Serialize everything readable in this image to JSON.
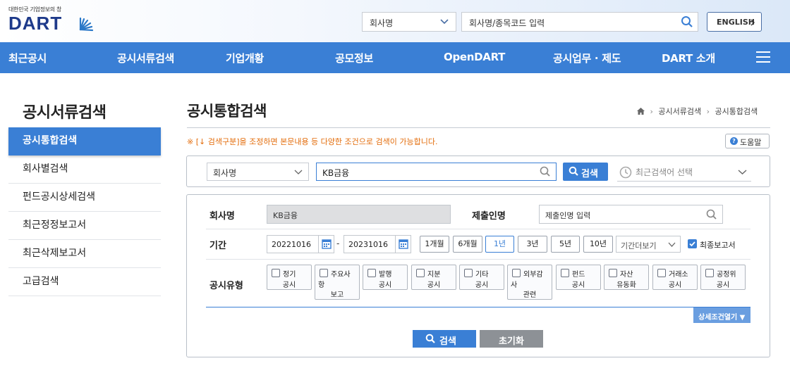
{
  "header": {
    "logo_tagline": "대한민국 기업정보의 창",
    "logo_word": "DART",
    "search_select": "회사명",
    "search_placeholder": "회사명/종목코드 입력",
    "english_label": "ENGLISH"
  },
  "nav": {
    "items": [
      "최근공시",
      "공시서류검색",
      "기업개황",
      "공모정보",
      "OpenDART",
      "공시업무 · 제도",
      "DART 소개"
    ]
  },
  "sidebar": {
    "title": "공시서류검색",
    "items": [
      "공시통합검색",
      "회사별검색",
      "펀드공시상세검색",
      "최근정정보고서",
      "최근삭제보고서",
      "고급검색"
    ]
  },
  "main": {
    "title": "공시통합검색",
    "breadcrumb": [
      "공시서류검색",
      "공시통합검색"
    ],
    "notice": "※ [↓ 검색구분]을 조정하면 본문내용 등 다양한 조건으로 검색이 가능합니다.",
    "help_label": "도움말"
  },
  "search_bar": {
    "select_value": "회사명",
    "input_value": "KB금융",
    "search_label": "검색",
    "recent_placeholder": "최근검색어 선택"
  },
  "filters": {
    "company_label": "회사명",
    "company_value": "KB금융",
    "submitter_label": "제출인명",
    "submitter_placeholder": "제출인명 입력",
    "period_label": "기간",
    "date_from": "20221016",
    "date_sep": "-",
    "date_to": "20231016",
    "period_buttons": [
      "1개월",
      "6개월",
      "1년",
      "3년",
      "5년",
      "10년"
    ],
    "period_more": "기간더보기",
    "final_report_label": "최종보고서",
    "type_label": "공시유형",
    "types": [
      {
        "l1": "정기",
        "l2": "공시"
      },
      {
        "l1": "주요사",
        "l2": "항",
        "l3": "보고"
      },
      {
        "l1": "발행",
        "l2": "공시"
      },
      {
        "l1": "지분",
        "l2": "공시"
      },
      {
        "l1": "기타",
        "l2": "공시"
      },
      {
        "l1": "외부감",
        "l2": "사",
        "l3": "관련"
      },
      {
        "l1": "펀드",
        "l2": "공시"
      },
      {
        "l1": "자산",
        "l2": "유동화"
      },
      {
        "l1": "거래소",
        "l2": "공시"
      },
      {
        "l1": "공정위",
        "l2": "공시"
      }
    ],
    "detail_toggle": "상세조건열기 ▼",
    "bottom_search": "검색",
    "reset": "초기화"
  }
}
